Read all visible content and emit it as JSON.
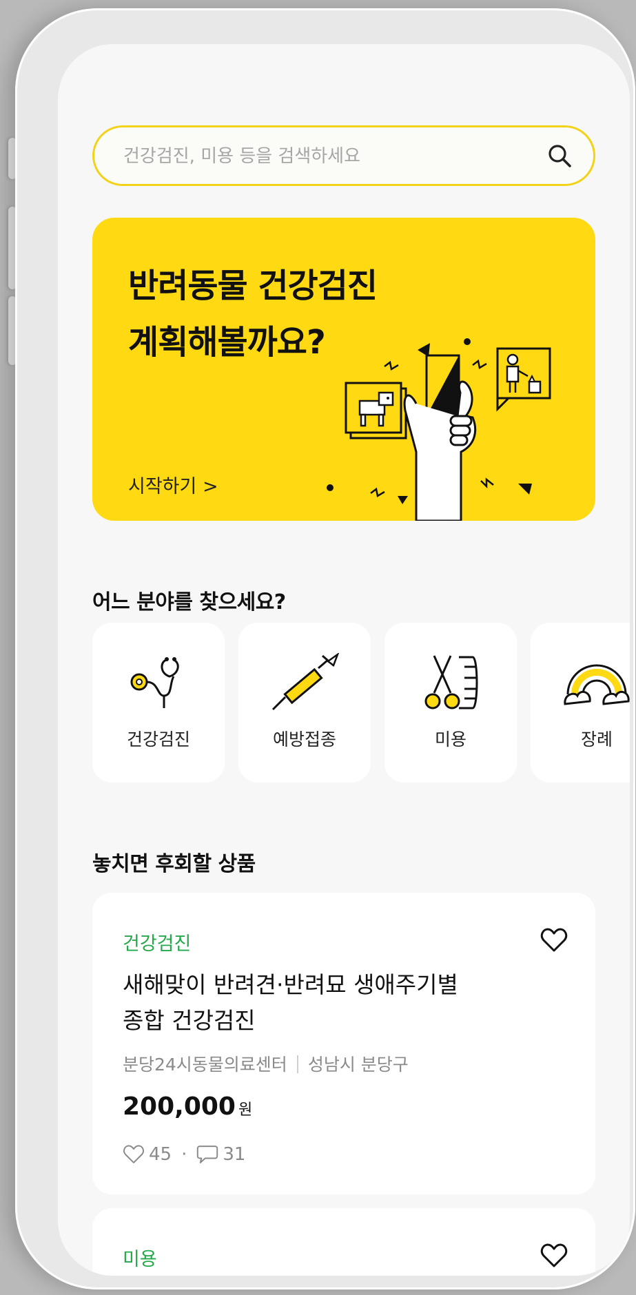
{
  "search": {
    "placeholder": "건강검진, 미용 등을 검색하세요",
    "icon": "search-icon"
  },
  "banner": {
    "title_line1": "반려동물 건강검진",
    "title_line2": "계획해볼까요?",
    "cta": "시작하기 >",
    "background": "#ffd912"
  },
  "categories": {
    "title": "어느 분야를 찾으세요?",
    "items": [
      {
        "label": "건강검진",
        "icon": "stethoscope-icon"
      },
      {
        "label": "예방접종",
        "icon": "syringe-icon"
      },
      {
        "label": "미용",
        "icon": "scissors-comb-icon"
      },
      {
        "label": "장례",
        "icon": "rainbow-icon"
      }
    ]
  },
  "products": {
    "title": "놓치면 후회할 상품",
    "items": [
      {
        "tag": "건강검진",
        "title_line1": "새해맞이 반려견·반려묘 생애주기별",
        "title_line2": "종합 건강검진",
        "clinic": "분당24시동물의료센터",
        "location": "성남시 분당구",
        "price": "200,000",
        "currency": "원",
        "likes": "45",
        "comments": "31"
      },
      {
        "tag": "미용"
      }
    ]
  },
  "colors": {
    "accent": "#ffd912",
    "tag": "#25a84a",
    "search_border": "#f3d21a"
  }
}
